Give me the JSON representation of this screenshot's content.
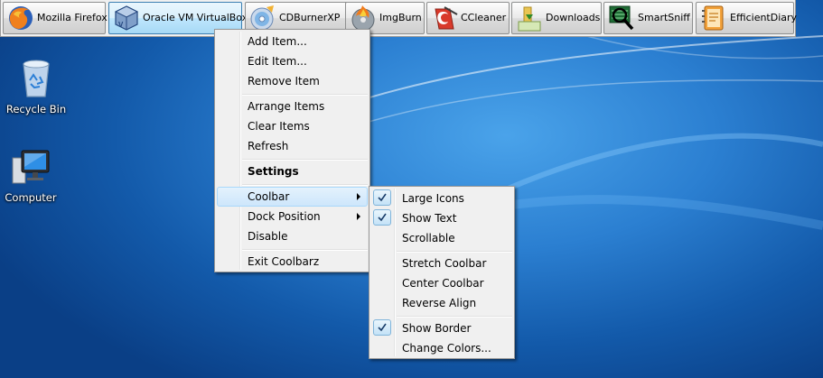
{
  "coolbar": {
    "items": [
      {
        "label": "Mozilla Firefox",
        "icon": "firefox-icon"
      },
      {
        "label": "Oracle VM VirtualBox",
        "icon": "virtualbox-icon"
      },
      {
        "label": "CDBurnerXP",
        "icon": "cdburnerxp-icon"
      },
      {
        "label": "ImgBurn",
        "icon": "imgburn-icon"
      },
      {
        "label": "CCleaner",
        "icon": "ccleaner-icon"
      },
      {
        "label": "Downloads",
        "icon": "downloads-folder-icon"
      },
      {
        "label": "SmartSniff",
        "icon": "smartsniff-icon"
      },
      {
        "label": "EfficientDiary",
        "icon": "efficientdiary-icon"
      }
    ]
  },
  "desktop": {
    "icons": [
      {
        "label": "Recycle Bin",
        "icon": "recycle-bin-icon"
      },
      {
        "label": "Computer",
        "icon": "computer-icon"
      }
    ]
  },
  "context_menu": {
    "items": [
      {
        "label": "Add Item..."
      },
      {
        "label": "Edit Item..."
      },
      {
        "label": "Remove Item"
      },
      {
        "label": "Arrange Items"
      },
      {
        "label": "Clear Items"
      },
      {
        "label": "Refresh"
      },
      {
        "label": "Settings",
        "bold": true
      },
      {
        "label": "Coolbar",
        "submenu": true,
        "highlighted": true
      },
      {
        "label": "Dock Position",
        "submenu": true
      },
      {
        "label": "Disable"
      },
      {
        "label": "Exit Coolbarz"
      }
    ]
  },
  "coolbar_submenu": {
    "items": [
      {
        "label": "Large Icons",
        "checked": true
      },
      {
        "label": "Show Text",
        "checked": true
      },
      {
        "label": "Scrollable",
        "checked": false
      },
      {
        "label": "Stretch Coolbar",
        "checked": false
      },
      {
        "label": "Center Coolbar",
        "checked": false
      },
      {
        "label": "Reverse Align",
        "checked": false
      },
      {
        "label": "Show Border",
        "checked": true
      },
      {
        "label": "Change Colors...",
        "checked": false
      }
    ]
  },
  "colors": {
    "desktop_blue": "#1e6fc4",
    "menu_background": "#f0f0f0",
    "highlight": "#cde6fb"
  }
}
